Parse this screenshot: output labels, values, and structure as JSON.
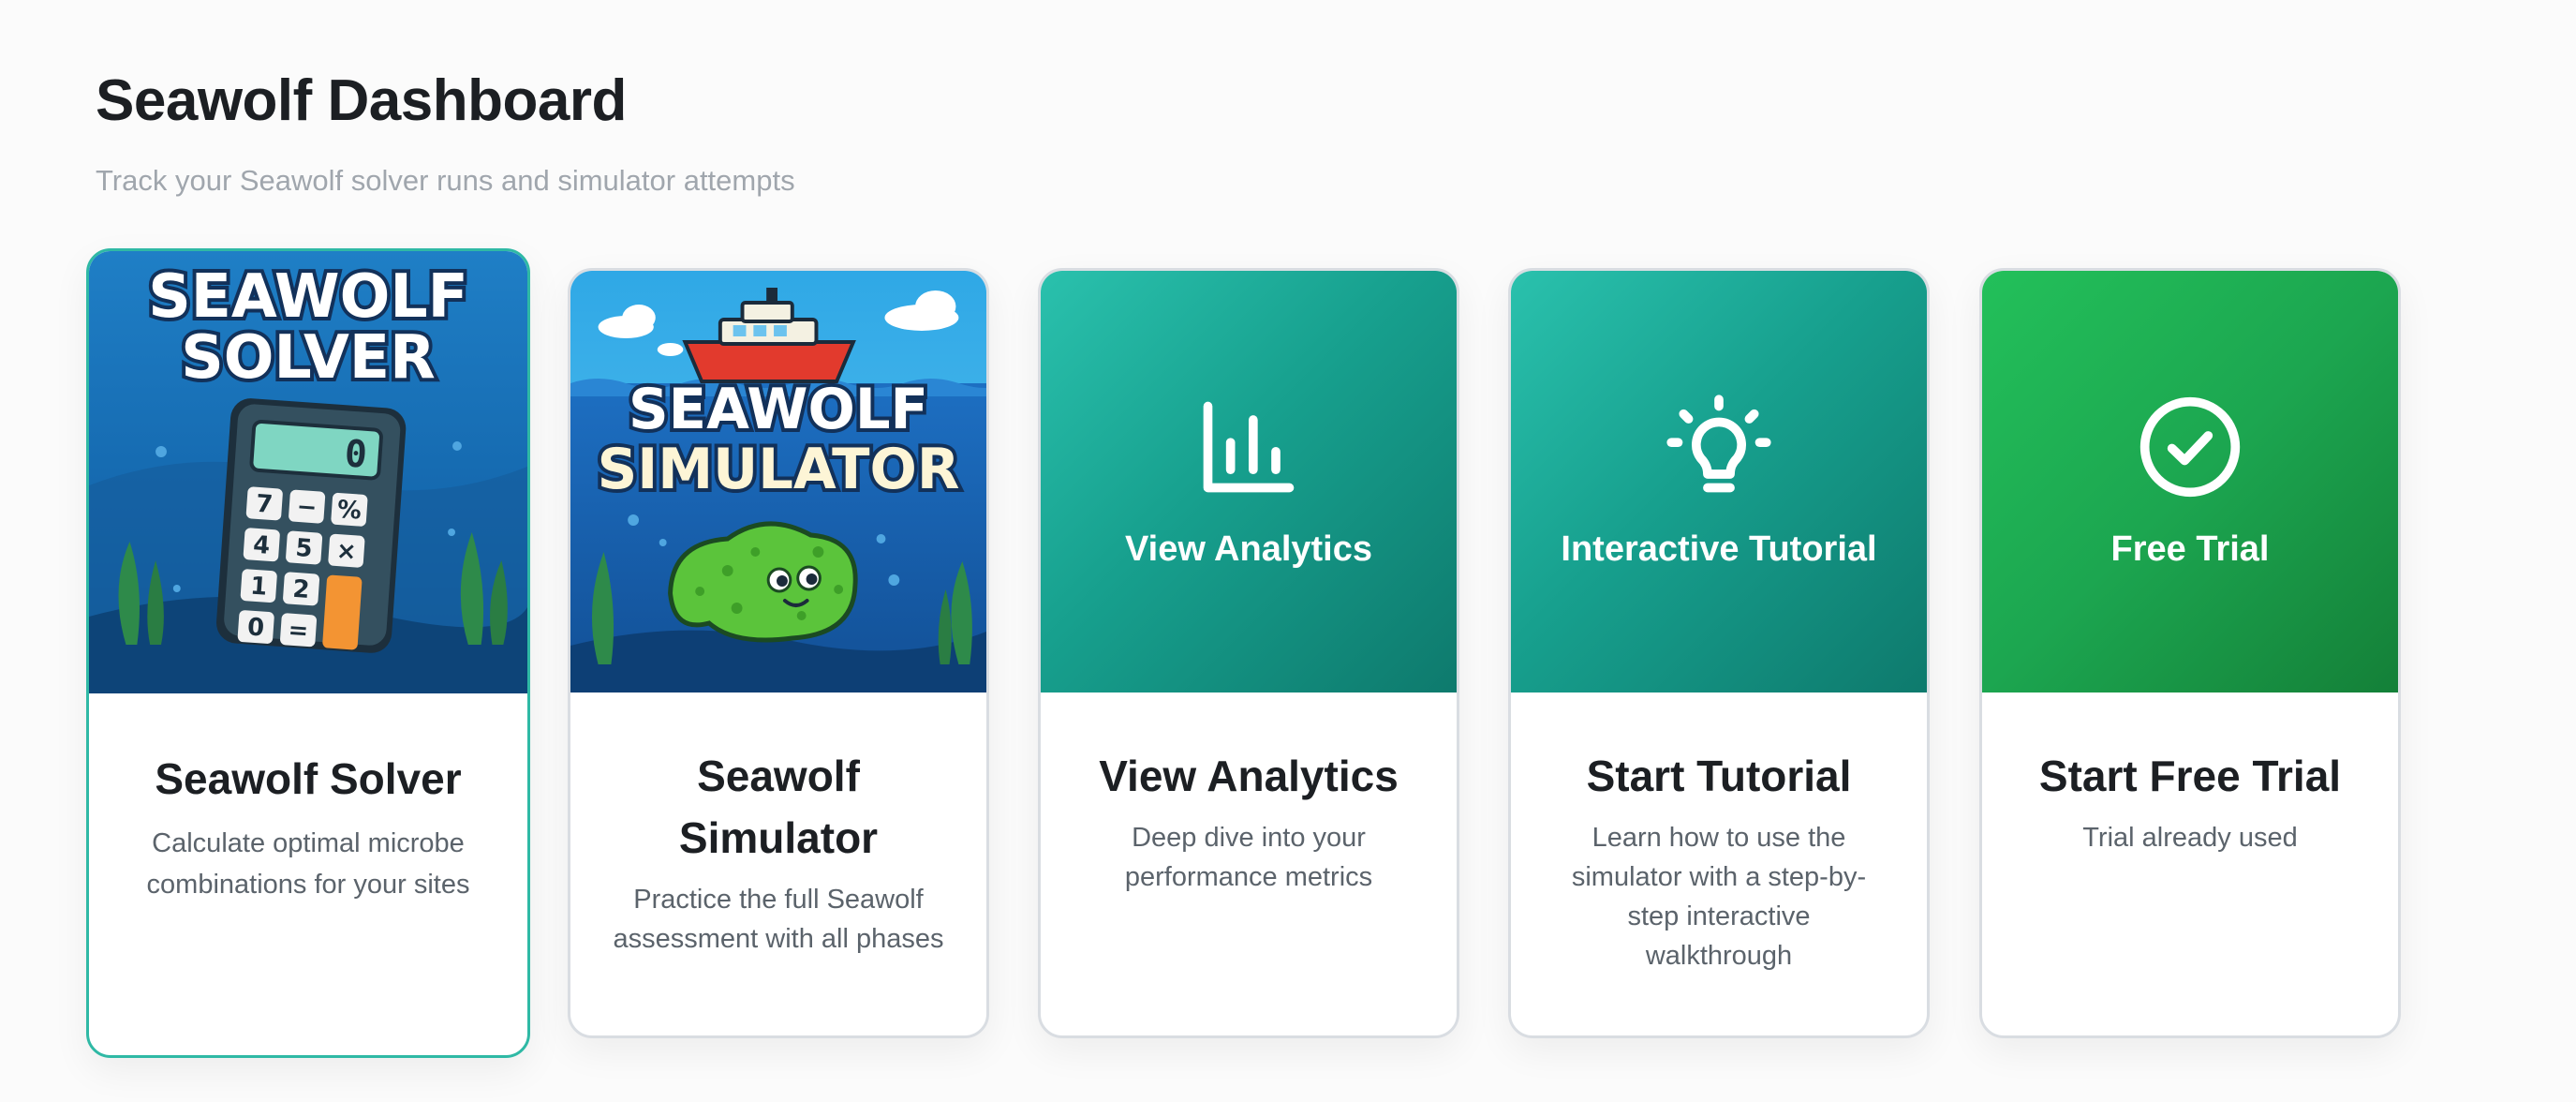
{
  "header": {
    "title": "Seawolf Dashboard",
    "subtitle": "Track your Seawolf solver runs and simulator attempts"
  },
  "cards": [
    {
      "image_title_line1": "SEAWOLF",
      "image_title_line2": "SOLVER",
      "calculator_display": "0",
      "calculator_keys": [
        "7",
        "−",
        "%",
        "4",
        "5",
        "×",
        "1",
        "2",
        "0",
        "="
      ],
      "title": "Seawolf Solver",
      "description": "Calculate optimal microbe combinations for your sites",
      "selected": true
    },
    {
      "image_title_line1": "SEAWOLF",
      "image_title_line2": "SIMULATOR",
      "title": "Seawolf Simulator",
      "description": "Practice the full Seawolf assessment with all phases"
    },
    {
      "media_label": "View Analytics",
      "media_icon": "bar-chart-icon",
      "title": "View Analytics",
      "description": "Deep dive into your performance metrics"
    },
    {
      "media_label": "Interactive Tutorial",
      "media_icon": "lightbulb-icon",
      "title": "Start Tutorial",
      "description": "Learn how to use the simulator with a step-by-step interactive walkthrough"
    },
    {
      "media_label": "Free Trial",
      "media_icon": "check-circle-icon",
      "title": "Start Free Trial",
      "description": "Trial already used"
    }
  ],
  "colors": {
    "accent_teal": "#2fb9a5",
    "teal_gradient": [
      "#2ac1ad",
      "#0e7a6d"
    ],
    "green_gradient": [
      "#23c05a",
      "#148038"
    ],
    "title_text": "#1c1f23",
    "muted_text": "#a0a6ad"
  }
}
